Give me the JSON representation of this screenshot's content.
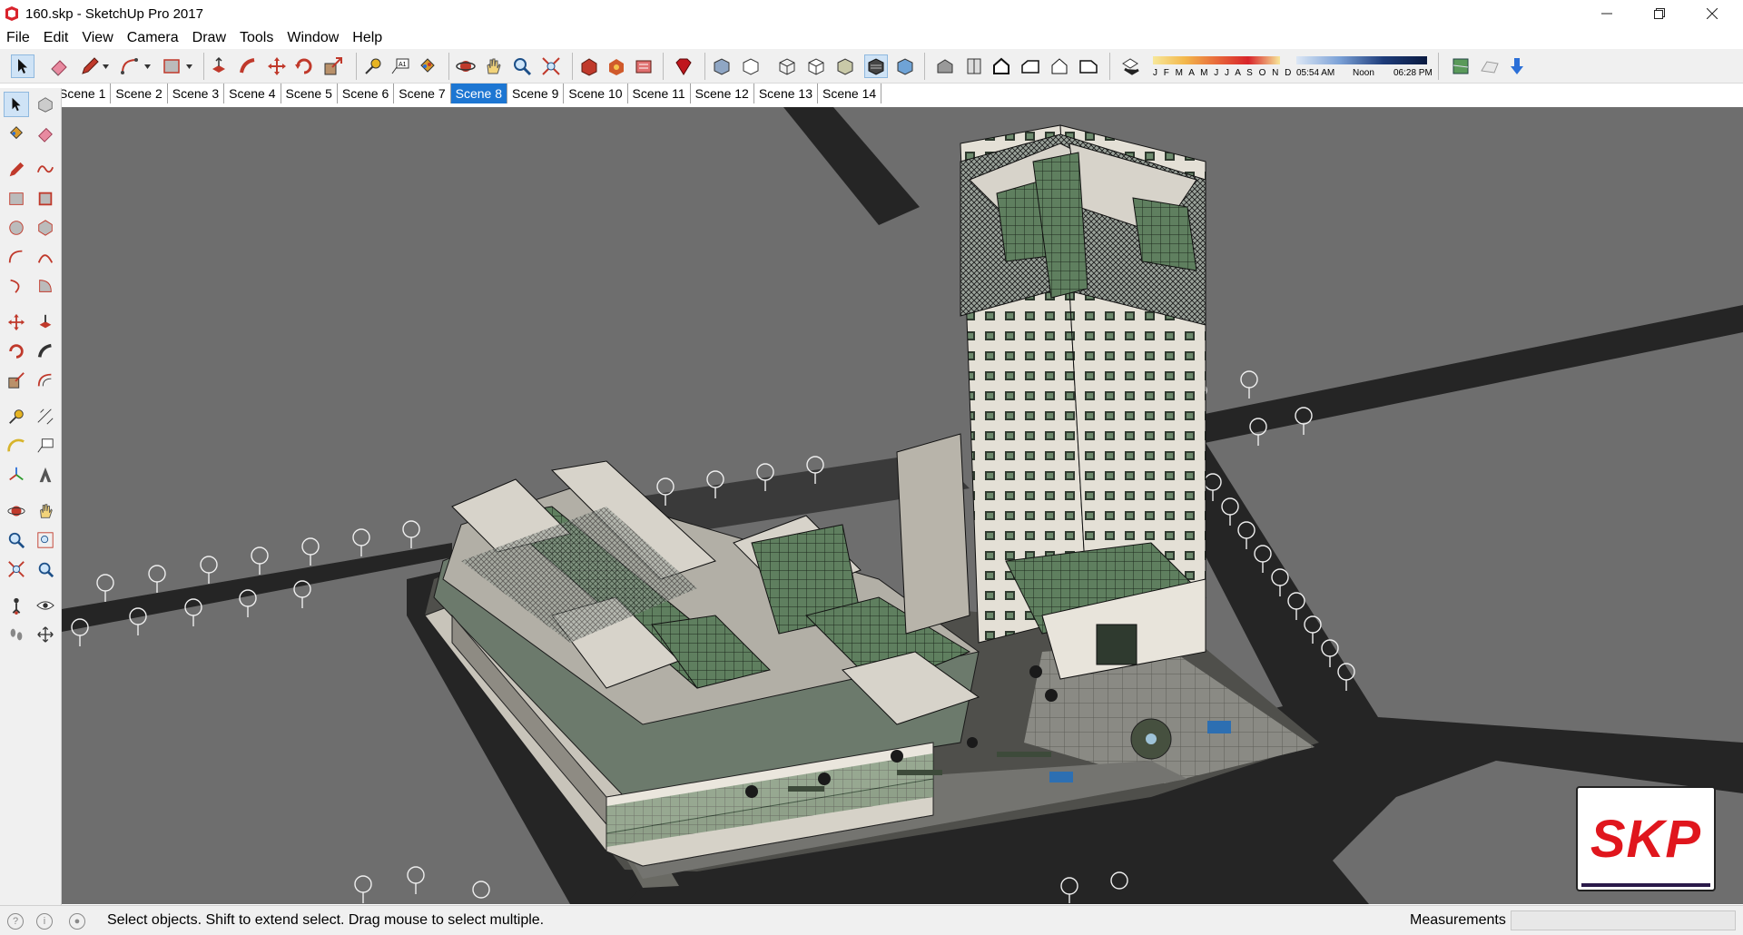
{
  "window": {
    "title": "160.skp - SketchUp Pro 2017",
    "minimize_icon": "minimize-icon",
    "maximize_icon": "restore-icon",
    "close_icon": "close-icon"
  },
  "menu": [
    "File",
    "Edit",
    "View",
    "Camera",
    "Draw",
    "Tools",
    "Window",
    "Help"
  ],
  "toolbar": {
    "shadow_months": "J F M A M J J A S O N D",
    "time_start": "05:54 AM",
    "time_mid": "Noon",
    "time_end": "06:28 PM",
    "active_tool": "select-tool"
  },
  "scenes": {
    "tabs": [
      "Scene 1",
      "Scene 2",
      "Scene 3",
      "Scene 4",
      "Scene 5",
      "Scene 6",
      "Scene 7",
      "Scene 8",
      "Scene 9",
      "Scene 10",
      "Scene 11",
      "Scene 12",
      "Scene 13",
      "Scene 14"
    ],
    "active": "Scene 8"
  },
  "status": {
    "message": "Select objects. Shift to extend select. Drag mouse to select multiple.",
    "measurements_label": "Measurements",
    "measurements_value": ""
  },
  "watermark": {
    "text": "SKP"
  },
  "colors": {
    "accent": "#1d76d2",
    "viewport_bg": "#6e6e6e",
    "road": "#252525",
    "glass": "#5f7f5f",
    "brand_red": "#e0161d"
  }
}
